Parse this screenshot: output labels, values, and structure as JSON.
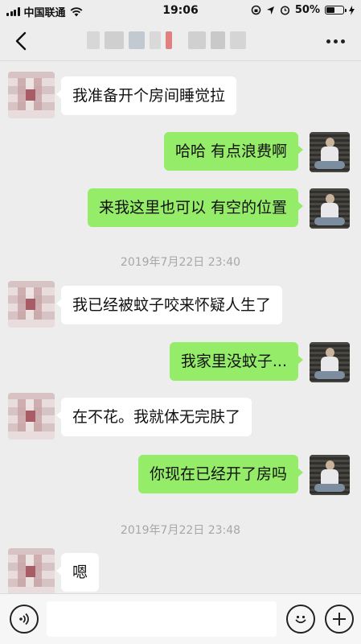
{
  "status_bar": {
    "carrier": "中国联通",
    "time": "19:06",
    "battery": "50%",
    "battery_level": 0.5
  },
  "nav": {
    "back_icon": "chevron-left-icon",
    "more_icon": "more-dots-icon"
  },
  "messages": [
    {
      "side": "left",
      "text": "我准备开个房间睡觉拉"
    },
    {
      "side": "right",
      "text": "哈哈 有点浪费啊"
    },
    {
      "side": "right",
      "text": "来我这里也可以 有空的位置"
    },
    {
      "side": "time",
      "text": "2019年7月22日 23:40"
    },
    {
      "side": "left",
      "text": "我已经被蚊子咬来怀疑人生了"
    },
    {
      "side": "right",
      "text": "我家里没蚊子..."
    },
    {
      "side": "left",
      "text": "在不花。我就体无完肤了"
    },
    {
      "side": "right",
      "text": "你现在已经开了房吗"
    },
    {
      "side": "time",
      "text": "2019年7月22日 23:48"
    },
    {
      "side": "left",
      "text": "嗯"
    }
  ],
  "input_bar": {
    "voice_icon": "voice-icon",
    "emoji_icon": "emoji-icon",
    "plus_icon": "plus-icon"
  },
  "colors": {
    "background": "#ededed",
    "bubble_right": "#95ec69",
    "bubble_left": "#ffffff",
    "timestamp": "#a7a7a7"
  }
}
